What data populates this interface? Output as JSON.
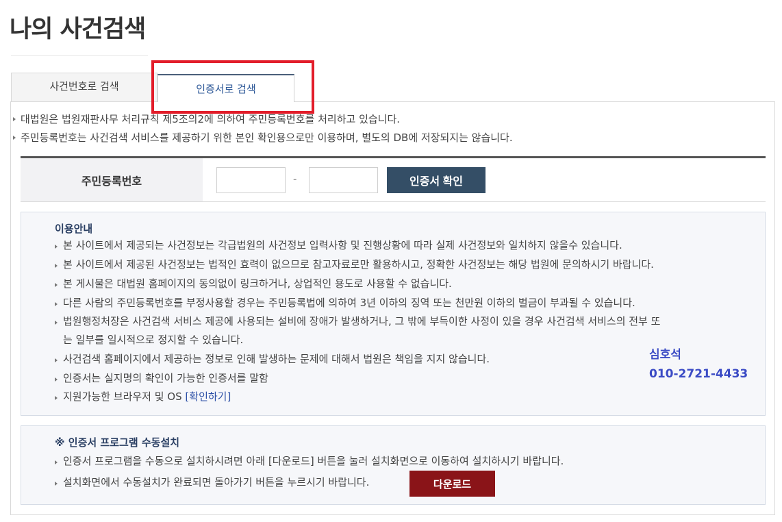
{
  "page": {
    "title": "나의 사건검색"
  },
  "tabs": [
    {
      "label": "사건번호로 검색",
      "active": false
    },
    {
      "label": "인증서로 검색",
      "active": true
    }
  ],
  "notices": [
    "대법원은 법원재판사무 처리규칙 제5조의2에 의하여 주민등록번호를 처리하고 있습니다.",
    "주민등록번호는 사건검색 서비스를 제공하기 위한 본인 확인용으로만 이용하며, 별도의 DB에 저장되지는 않습니다."
  ],
  "form": {
    "label": "주민등록번호",
    "field1_value": "",
    "field2_value": "",
    "separator": "-",
    "confirm_label": "인증서 확인"
  },
  "info": {
    "title": "이용안내",
    "items": [
      "본 사이트에서 제공되는 사건정보는 각급법원의 사건정보 입력사항 및 진행상황에 따라 실제 사건정보와 일치하지 않을수 있습니다.",
      "본 사이트에서 제공된 사건정보는 법적인 효력이 없으므로 참고자료로만 활용하시고, 정확한 사건정보는 해당 법원에 문의하시기 바랍니다.",
      "본 게시물은 대법원 홈페이지의 동의없이 링크하거나, 상업적인 용도로 사용할 수 없습니다.",
      "다른 사람의 주민등록번호를 부정사용할 경우는 주민등록법에 의하여 3년 이하의 징역 또는 천만원 이하의 벌금이 부과될 수 있습니다.",
      "법원행정처장은 사건검색 서비스 제공에 사용되는 설비에 장애가 발생하거나, 그 밖에 부득이한 사정이 있을 경우 사건검색 서비스의 전부 또",
      "는 일부를 일시적으로 정지할 수 있습니다.",
      "사건검색 홈페이지에서 제공하는 정보로 인해 발생하는 문제에 대해서 법원은 책임을 지지 않습니다.",
      "인증서는 실지명의 확인이 가능한 인증서를 말함",
      "지원가능한 브라우저 및 OS"
    ],
    "link_label": "[확인하기]"
  },
  "contact": {
    "name": "심호석",
    "phone": "010-2721-4433",
    "color": "#3b4bc5"
  },
  "install": {
    "title": "※ 인증서 프로그램 수동설치",
    "items": [
      "인증서 프로그램을 수동으로 설치하시려면 아래 [다운로드] 버튼을 눌러 설치화면으로 이동하여 설치하시기 바랍니다.",
      "설치화면에서 수동설치가 완료되면 돌아가기 버튼을 누르시기 바랍니다."
    ],
    "download_label": "다운로드"
  },
  "colors": {
    "highlight": "#e21d2a",
    "confirm_button": "#344e66",
    "download_button": "#8a1418",
    "active_tab_text": "#2c5797"
  }
}
